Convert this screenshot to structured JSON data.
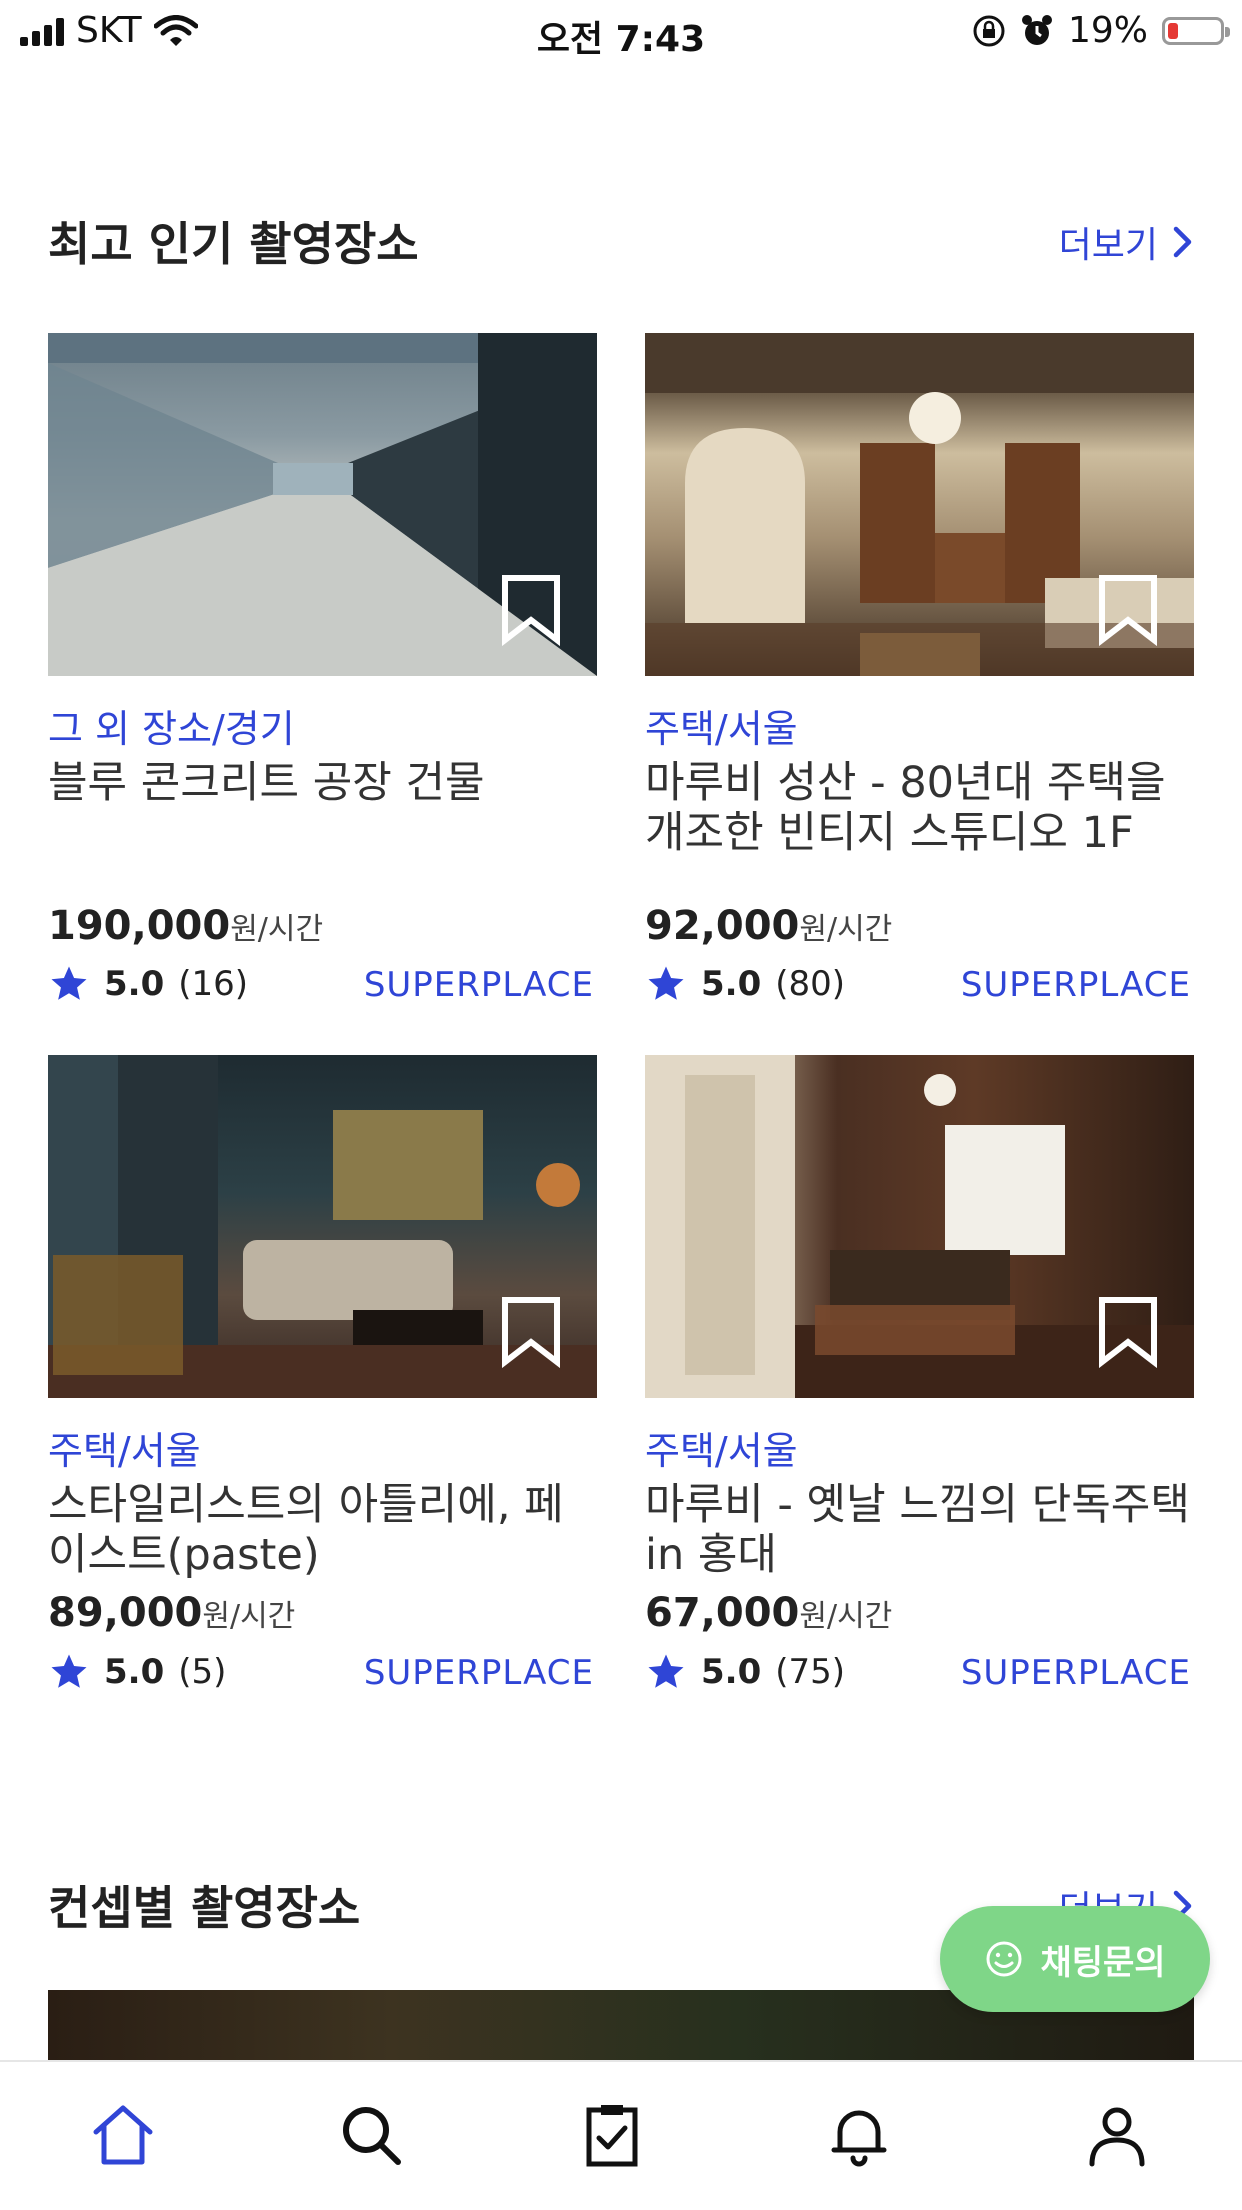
{
  "status_bar": {
    "carrier": "SKT",
    "time": "오전 7:43",
    "battery_percent": "19%",
    "battery_level": 0.19
  },
  "section_popular": {
    "title": "최고 인기 촬영장소",
    "more_label": "더보기"
  },
  "cards": [
    {
      "category": "그 외 장소/경기",
      "title": "블루 콘크리트 공장 건물",
      "price": "190,000",
      "price_unit": "원/시간",
      "rating": "5.0",
      "reviews": "(16)",
      "badge": "SUPERPLACE"
    },
    {
      "category": "주택/서울",
      "title": "마루비 성산 - 80년대 주택을 개조한 빈티지 스튜디오 1F",
      "price": "92,000",
      "price_unit": "원/시간",
      "rating": "5.0",
      "reviews": "(80)",
      "badge": "SUPERPLACE"
    },
    {
      "category": "주택/서울",
      "title": "스타일리스트의 아틀리에, 페이스트(paste)",
      "price": "89,000",
      "price_unit": "원/시간",
      "rating": "5.0",
      "reviews": "(5)",
      "badge": "SUPERPLACE"
    },
    {
      "category": "주택/서울",
      "title": "마루비 - 옛날 느낌의 단독주택 in 홍대",
      "price": "67,000",
      "price_unit": "원/시간",
      "rating": "5.0",
      "reviews": "(75)",
      "badge": "SUPERPLACE"
    }
  ],
  "section_concept": {
    "title": "컨셉별 촬영장소",
    "more_label": "더보기"
  },
  "chat_button": {
    "label": "채팅문의"
  },
  "tabbar": {
    "items": [
      "home-icon",
      "search-icon",
      "clipboard-check-icon",
      "bell-icon",
      "person-icon"
    ],
    "active_color": "#3045d6"
  },
  "colors": {
    "accent": "#2f45d6",
    "chat": "#7fd688"
  }
}
